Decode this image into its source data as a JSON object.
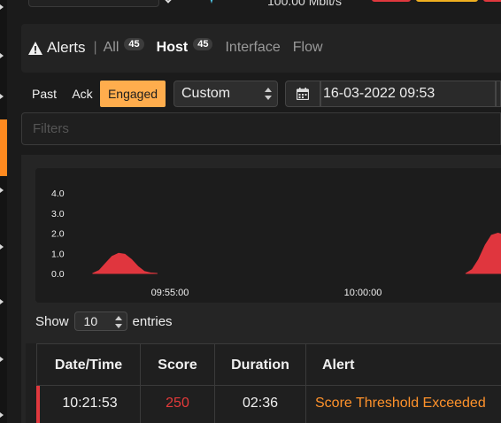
{
  "topbar": {
    "speed": "100.00 Mbit/s"
  },
  "nav": {
    "title": "Alerts",
    "tabs": [
      {
        "label": "All",
        "count": "45"
      },
      {
        "label": "Host",
        "count": "45"
      },
      {
        "label": "Interface"
      },
      {
        "label": "Flow"
      }
    ]
  },
  "filters_bar": {
    "buttons": [
      "Past",
      "Ack",
      "Engaged"
    ],
    "active_button": "Engaged",
    "range_select": "Custom",
    "date_value": "16-03-2022 09:53"
  },
  "filter_input": {
    "placeholder": "Filters"
  },
  "chart_data": {
    "type": "area",
    "y_ticks": [
      "4.0",
      "3.0",
      "2.0",
      "1.0",
      "0.0"
    ],
    "x_ticks": [
      "09:55:00",
      "10:00:00"
    ],
    "ylim": [
      0,
      4
    ],
    "series": [
      {
        "x": [
          "09:53:00",
          "09:53:10",
          "09:53:20",
          "09:53:30",
          "09:53:40",
          "09:53:50",
          "09:54:00",
          "09:54:10",
          "09:54:20",
          "09:54:30",
          "09:54:40"
        ],
        "values": [
          0,
          0.15,
          0.5,
          0.85,
          1.0,
          0.95,
          0.7,
          0.35,
          0.1,
          0.02,
          0
        ]
      },
      {
        "x": [
          "10:02:40",
          "10:02:50",
          "10:03:00",
          "10:03:10",
          "10:03:20",
          "10:03:30",
          "10:03:40"
        ],
        "values": [
          0,
          0.2,
          0.7,
          1.4,
          1.9,
          2.0,
          1.9
        ]
      }
    ],
    "color": "#e0363e"
  },
  "pagination": {
    "show_label": "Show",
    "entries_value": "10",
    "entries_label": "entries"
  },
  "table": {
    "columns": [
      "Date/Time",
      "Score",
      "Duration",
      "Alert"
    ],
    "rows": [
      {
        "datetime": "10:21:53",
        "score": "250",
        "duration": "02:36",
        "alert": "Score Threshold Exceeded"
      }
    ]
  },
  "colors": {
    "accent": "#ffad4d",
    "danger": "#e0383e",
    "alert_text": "#ff922b"
  }
}
